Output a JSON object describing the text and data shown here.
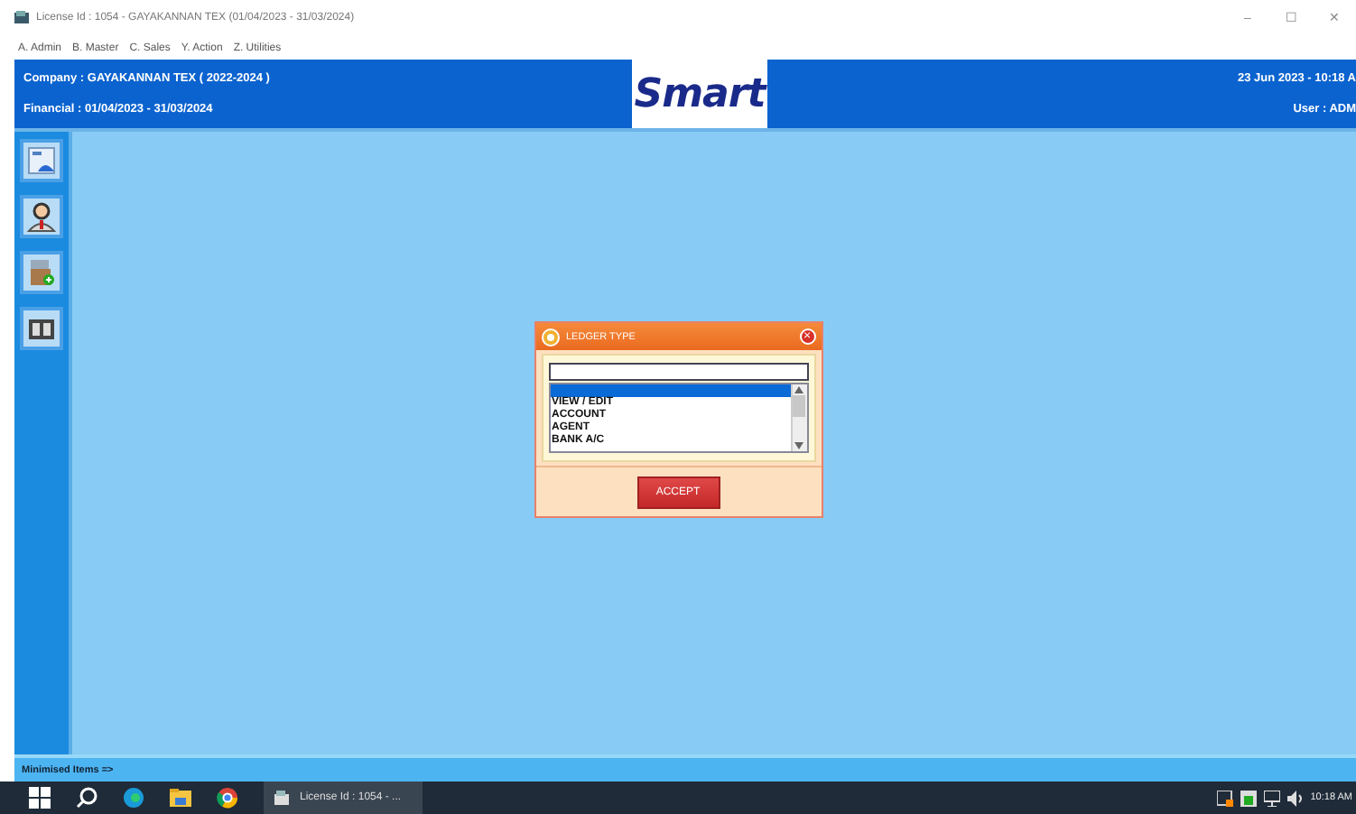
{
  "window": {
    "title": "License Id : 1054  -  GAYAKANNAN TEX (01/04/2023 - 31/03/2024)",
    "controls": [
      "–",
      "☐",
      "✕"
    ]
  },
  "menu": [
    "A. Admin",
    "B. Master",
    "C. Sales",
    "Y. Action",
    "Z. Utilities"
  ],
  "header": {
    "company": "Company : GAYAKANNAN TEX ( 2022-2024 )",
    "financial": "Financial : 01/04/2023 - 31/03/2024",
    "logo": "Smart",
    "datetime": "23 Jun 2023  -  10:18 A",
    "user": "User : ADM"
  },
  "sidebar": {
    "items": [
      {
        "kind": "report"
      },
      {
        "kind": "person"
      },
      {
        "kind": "box"
      },
      {
        "kind": "book"
      }
    ]
  },
  "dialog": {
    "title": "LEDGER TYPE",
    "close": "×",
    "search": {
      "focused": true
    },
    "items": [
      {
        "selected": true
      },
      {
        "label": "VIEW / EDIT",
        "selected": false
      },
      {
        "label": "ACCOUNT",
        "selected": false
      },
      {
        "label": "AGENT",
        "selected": false
      },
      {
        "label": "BANK A/C",
        "selected": false
      }
    ],
    "button": "ACCEPT"
  },
  "minimised": "Minimised Items =>",
  "taskbar": {
    "task": "License Id : 1054  -  ...",
    "clock": "10:18 AM"
  }
}
